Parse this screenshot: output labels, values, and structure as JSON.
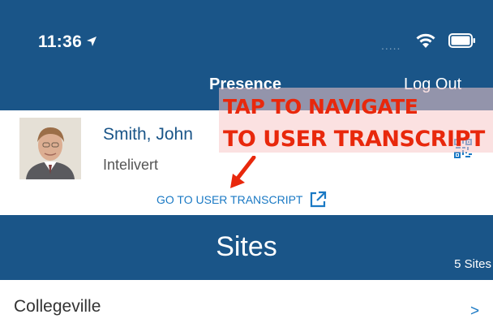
{
  "status_bar": {
    "time": "11:36",
    "signal": "....."
  },
  "nav": {
    "title": "Presence",
    "logout_label": "Log Out"
  },
  "profile": {
    "name": "Smith, John",
    "company": "Intelivert",
    "transcript_link": "GO TO USER TRANSCRIPT"
  },
  "annotation": {
    "line1": "TAP TO NAVIGATE",
    "line2": "TO USER TRANSCRIPT"
  },
  "sites": {
    "title": "Sites",
    "count": "5 Sites",
    "items": [
      {
        "name": "Collegeville",
        "chevron": ">"
      }
    ]
  },
  "colors": {
    "header_bg": "#1a5588",
    "link": "#1a79c4",
    "annotation": "#e8280c"
  }
}
